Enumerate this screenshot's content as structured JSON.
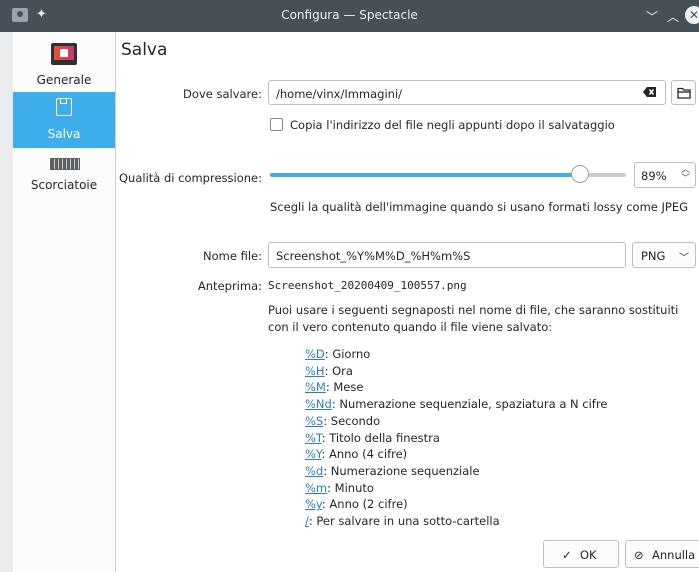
{
  "window": {
    "title": "Configura — Spectacle",
    "controls": {
      "minimize": "﹀",
      "maximize": "︿",
      "close": "✕"
    }
  },
  "sidebar": {
    "items": [
      {
        "label": "Generale",
        "icon": "display-icon",
        "active": false
      },
      {
        "label": "Salva",
        "icon": "save-icon",
        "active": true
      },
      {
        "label": "Scorciatoie",
        "icon": "keyboard-icon",
        "active": false
      }
    ]
  },
  "page": {
    "title": "Salva",
    "save_location": {
      "label": "Dove salvare:",
      "value": "/home/vinx/Immagini/"
    },
    "copy_path": {
      "label": "Copia l'indirizzo del file negli appunti dopo il salvataggio",
      "checked": false
    },
    "quality": {
      "label": "Qualità di compressione:",
      "value": 89,
      "display": "89%",
      "hint": "Scegli la qualità dell'immagine quando si usano formati lossy come JPEG"
    },
    "filename": {
      "label": "Nome file:",
      "value": "Screenshot_%Y%M%D_%H%m%S",
      "format": "PNG"
    },
    "preview": {
      "label": "Anteprima:",
      "value": "Screenshot_20200409_100557.png"
    },
    "help_text": "Puoi usare i seguenti segnaposti nel nome di file, che saranno sostituiti con il vero contenuto quando il file viene salvato:",
    "placeholders": [
      {
        "code": "%D",
        "desc": ": Giorno"
      },
      {
        "code": "%H",
        "desc": ": Ora"
      },
      {
        "code": "%M",
        "desc": ": Mese"
      },
      {
        "code": "%Nd",
        "desc": ": Numerazione sequenziale, spaziatura a N cifre"
      },
      {
        "code": "%S",
        "desc": ": Secondo"
      },
      {
        "code": "%T",
        "desc": ": Titolo della finestra"
      },
      {
        "code": "%Y",
        "desc": ": Anno (4 cifre)"
      },
      {
        "code": "%d",
        "desc": ": Numerazione sequenziale"
      },
      {
        "code": "%m",
        "desc": ": Minuto"
      },
      {
        "code": "%y",
        "desc": ": Anno (2 cifre)"
      },
      {
        "code": "/",
        "desc": ": Per salvare in una sotto-cartella"
      }
    ]
  },
  "buttons": {
    "ok": "OK",
    "cancel": "Annulla"
  },
  "colors": {
    "accent": "#3daee9",
    "titlebar": "#475057",
    "link": "#2980b9"
  }
}
